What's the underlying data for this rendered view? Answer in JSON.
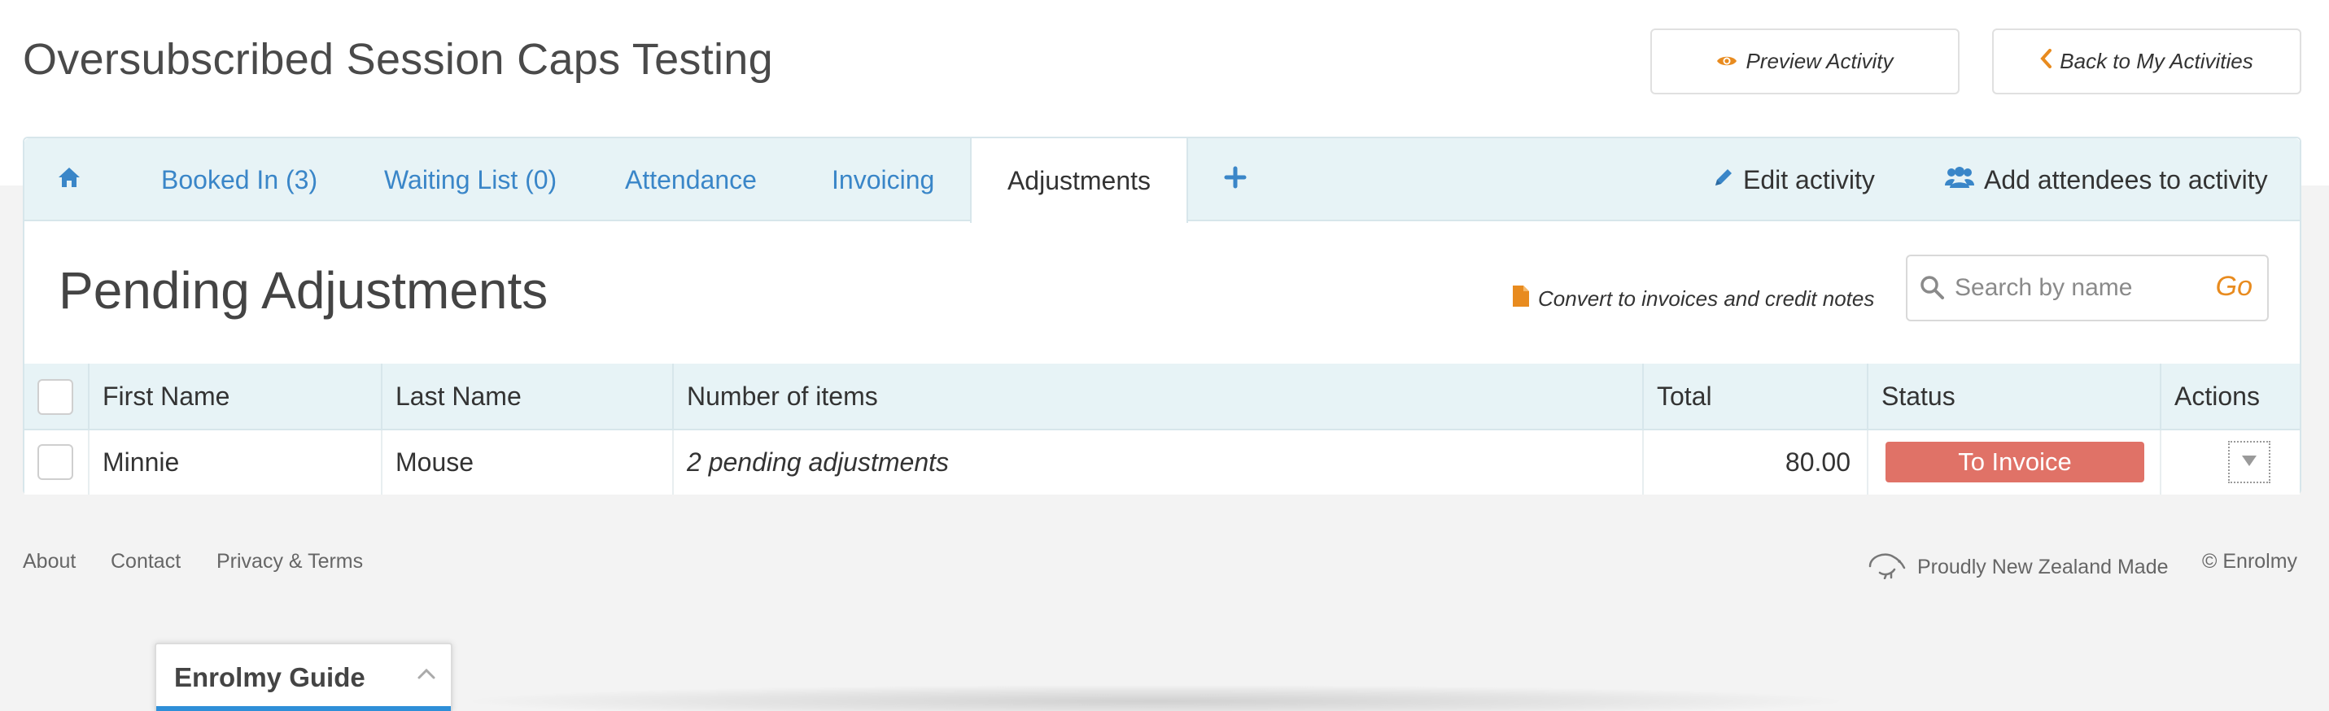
{
  "header": {
    "title": "Oversubscribed Session Caps Testing",
    "preview_button": "Preview Activity",
    "back_button": "Back to My Activities"
  },
  "tabs": [
    {
      "label": "Booked In (3)"
    },
    {
      "label": "Waiting List (0)"
    },
    {
      "label": "Attendance"
    },
    {
      "label": "Invoicing"
    },
    {
      "label": "Adjustments",
      "active": true
    }
  ],
  "tab_actions": {
    "edit": "Edit activity",
    "add_attendees": "Add attendees to activity"
  },
  "section": {
    "title": "Pending Adjustments",
    "convert_link": "Convert to invoices and credit notes",
    "search_placeholder": "Search by name",
    "search_go": "Go"
  },
  "table": {
    "columns": [
      "First Name",
      "Last Name",
      "Number of items",
      "Total",
      "Status",
      "Actions"
    ],
    "rows": [
      {
        "first_name": "Minnie",
        "last_name": "Mouse",
        "items": "2 pending adjustments",
        "total": "80.00",
        "status": "To Invoice"
      }
    ]
  },
  "footer": {
    "links": [
      "About",
      "Contact",
      "Privacy & Terms"
    ],
    "made_in": "Proudly New Zealand Made",
    "copyright": "© Enrolmy"
  },
  "guide": {
    "title": "Enrolmy Guide"
  },
  "colors": {
    "link_blue": "#3a86c8",
    "accent_orange": "#e88b1f",
    "status_red": "#e07267",
    "tab_bg": "#e7f3f6",
    "guide_bar": "#2e8fd8"
  },
  "icons": {
    "home": "home-icon",
    "plus": "plus-icon",
    "preview": "eye-icon",
    "back": "chevron-left-icon",
    "edit": "pencil-icon",
    "add_attendees": "users-icon",
    "convert": "file-icon",
    "search": "search-icon",
    "actions": "caret-down-icon",
    "made_in": "kiwi-icon",
    "guide_toggle": "chevron-up-icon"
  }
}
